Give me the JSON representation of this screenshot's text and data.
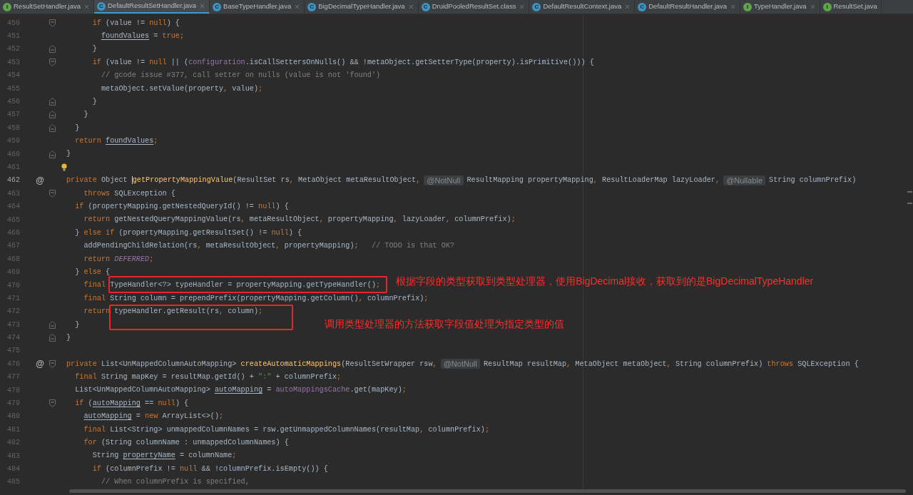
{
  "tabs": [
    {
      "label": "ResultSetHandler.java",
      "kind": "interface",
      "icon_letter": "I",
      "selected": false,
      "closable": true
    },
    {
      "label": "DefaultResultSetHandler.java",
      "kind": "class",
      "icon_letter": "C",
      "selected": true,
      "closable": true
    },
    {
      "label": "BaseTypeHandler.java",
      "kind": "class",
      "icon_letter": "C",
      "selected": false,
      "closable": true
    },
    {
      "label": "BigDecimalTypeHandler.java",
      "kind": "class",
      "icon_letter": "C",
      "selected": false,
      "closable": true
    },
    {
      "label": "DruidPooledResultSet.class",
      "kind": "class",
      "icon_letter": "C",
      "selected": false,
      "closable": true
    },
    {
      "label": "DefaultResultContext.java",
      "kind": "class",
      "icon_letter": "C",
      "selected": false,
      "closable": true
    },
    {
      "label": "DefaultResultHandler.java",
      "kind": "class",
      "icon_letter": "C",
      "selected": false,
      "closable": true
    },
    {
      "label": "TypeHandler.java",
      "kind": "interface",
      "icon_letter": "I",
      "selected": false,
      "closable": true
    },
    {
      "label": "ResultSet.java",
      "kind": "interface",
      "icon_letter": "I",
      "selected": false,
      "closable": false
    }
  ],
  "editor": {
    "lines": [
      {
        "number": "450",
        "current": false,
        "fold_marker": {
          "kind": "start"
        },
        "tokens": [
          {
            "kind": "keyword",
            "text": "      if"
          },
          {
            "kind": "plain",
            "text": " (value != "
          },
          {
            "kind": "keyword",
            "text": "null"
          },
          {
            "kind": "plain",
            "text": ") {"
          }
        ]
      },
      {
        "number": "451",
        "current": false,
        "tokens": [
          {
            "kind": "reassigned",
            "text": "        foundValues"
          },
          {
            "kind": "plain",
            "text": " = "
          },
          {
            "kind": "keyword",
            "text": "true;"
          }
        ]
      },
      {
        "number": "452",
        "current": false,
        "fold_marker": {
          "kind": "end"
        },
        "tokens": [
          {
            "kind": "plain",
            "text": "      }"
          }
        ]
      },
      {
        "number": "453",
        "current": false,
        "fold_marker": {
          "kind": "start"
        },
        "tokens": [
          {
            "kind": "keyword",
            "text": "      if"
          },
          {
            "kind": "plain",
            "text": " (value != "
          },
          {
            "kind": "keyword",
            "text": "null"
          },
          {
            "kind": "plain",
            "text": " || ("
          },
          {
            "kind": "field",
            "text": "configuration"
          },
          {
            "kind": "plain",
            "text": ".isCallSettersOnNulls() && !metaObject.getSetterType(property).isPrimitive())) {"
          }
        ]
      },
      {
        "number": "454",
        "current": false,
        "tokens": [
          {
            "kind": "comment",
            "text": "        // gcode issue #377, call setter on nulls (value is not 'found')"
          }
        ]
      },
      {
        "number": "455",
        "current": false,
        "tokens": [
          {
            "kind": "plain",
            "text": "        metaObject.setValue(property"
          },
          {
            "kind": "keyword",
            "text": ","
          },
          {
            "kind": "plain",
            "text": " value)"
          },
          {
            "kind": "keyword",
            "text": ";"
          }
        ]
      },
      {
        "number": "456",
        "current": false,
        "fold_marker": {
          "kind": "end"
        },
        "tokens": [
          {
            "kind": "plain",
            "text": "      }"
          }
        ]
      },
      {
        "number": "457",
        "current": false,
        "fold_marker": {
          "kind": "end"
        },
        "tokens": [
          {
            "kind": "plain",
            "text": "    }"
          }
        ]
      },
      {
        "number": "458",
        "current": false,
        "fold_marker": {
          "kind": "end"
        },
        "tokens": [
          {
            "kind": "plain",
            "text": "  }"
          }
        ]
      },
      {
        "number": "459",
        "current": false,
        "tokens": [
          {
            "kind": "keyword",
            "text": "  return "
          },
          {
            "kind": "reassigned",
            "text": "foundValues"
          },
          {
            "kind": "keyword",
            "text": ";"
          }
        ]
      },
      {
        "number": "460",
        "current": false,
        "fold_marker": {
          "kind": "end"
        },
        "tokens": [
          {
            "kind": "plain",
            "text": "}"
          }
        ]
      },
      {
        "number": "461",
        "current": false,
        "bulb": true
      },
      {
        "number": "462",
        "current": true,
        "gutter_mark": "@",
        "tokens": [
          {
            "kind": "keyword",
            "text": "private "
          },
          {
            "kind": "plain",
            "text": "Object "
          },
          {
            "kind": "method",
            "text": "getPropertyMappingValue",
            "cursor": true
          },
          {
            "kind": "plain",
            "text": "(ResultSet rs"
          },
          {
            "kind": "keyword",
            "text": ","
          },
          {
            "kind": "plain",
            "text": " MetaObject metaResultObject"
          },
          {
            "kind": "keyword",
            "text": ","
          },
          {
            "kind": "hint",
            "text": "@NotNull"
          },
          {
            "kind": "plain",
            "text": "ResultMapping propertyMapping"
          },
          {
            "kind": "keyword",
            "text": ","
          },
          {
            "kind": "plain",
            "text": " ResultLoaderMap lazyLoader"
          },
          {
            "kind": "keyword",
            "text": ","
          },
          {
            "kind": "hint",
            "text": "@Nullable"
          },
          {
            "kind": "plain",
            "text": "String columnPrefix)"
          }
        ]
      },
      {
        "number": "463",
        "current": false,
        "fold_marker": {
          "kind": "start"
        },
        "tokens": [
          {
            "kind": "keyword",
            "text": "    throws "
          },
          {
            "kind": "plain",
            "text": "SQLException {"
          }
        ]
      },
      {
        "number": "464",
        "current": false,
        "tokens": [
          {
            "kind": "keyword",
            "text": "  if "
          },
          {
            "kind": "plain",
            "text": "(propertyMapping.getNestedQueryId() != "
          },
          {
            "kind": "keyword",
            "text": "null"
          },
          {
            "kind": "plain",
            "text": ") {"
          }
        ]
      },
      {
        "number": "465",
        "current": false,
        "tokens": [
          {
            "kind": "keyword",
            "text": "    return "
          },
          {
            "kind": "plain",
            "text": "getNestedQueryMappingValue(rs"
          },
          {
            "kind": "keyword",
            "text": ","
          },
          {
            "kind": "plain",
            "text": " metaResultObject"
          },
          {
            "kind": "keyword",
            "text": ","
          },
          {
            "kind": "plain",
            "text": " propertyMapping"
          },
          {
            "kind": "keyword",
            "text": ","
          },
          {
            "kind": "plain",
            "text": " lazyLoader"
          },
          {
            "kind": "keyword",
            "text": ","
          },
          {
            "kind": "plain",
            "text": " columnPrefix)"
          },
          {
            "kind": "keyword",
            "text": ";"
          }
        ]
      },
      {
        "number": "466",
        "current": false,
        "tokens": [
          {
            "kind": "plain",
            "text": "  } "
          },
          {
            "kind": "keyword",
            "text": "else if "
          },
          {
            "kind": "plain",
            "text": "(propertyMapping.getResultSet() != "
          },
          {
            "kind": "keyword",
            "text": "null"
          },
          {
            "kind": "plain",
            "text": ") {"
          }
        ]
      },
      {
        "number": "467",
        "current": false,
        "tokens": [
          {
            "kind": "plain",
            "text": "    addPendingChildRelation(rs"
          },
          {
            "kind": "keyword",
            "text": ","
          },
          {
            "kind": "plain",
            "text": " metaResultObject"
          },
          {
            "kind": "keyword",
            "text": ","
          },
          {
            "kind": "plain",
            "text": " propertyMapping)"
          },
          {
            "kind": "keyword",
            "text": ";"
          },
          {
            "kind": "comment",
            "text": "   // TODO is that OK?"
          }
        ]
      },
      {
        "number": "468",
        "current": false,
        "tokens": [
          {
            "kind": "keyword",
            "text": "    return "
          },
          {
            "kind": "constant",
            "text": "DEFERRED"
          },
          {
            "kind": "keyword",
            "text": ";"
          }
        ]
      },
      {
        "number": "469",
        "current": false,
        "tokens": [
          {
            "kind": "plain",
            "text": "  } "
          },
          {
            "kind": "keyword",
            "text": "else "
          },
          {
            "kind": "plain",
            "text": "{"
          }
        ]
      },
      {
        "number": "470",
        "current": false,
        "tokens": [
          {
            "kind": "keyword",
            "text": "    final "
          },
          {
            "kind": "framed",
            "callout": "根据字段的类型获取到类型处理器，使用BigDecimal接收，获取到的是BigDecimalTypeHandler",
            "tokens": [
              {
                "kind": "plain",
                "text": "TypeHandler<?> typeHandler = propertyMapping.getTypeHandler()"
              },
              {
                "kind": "keyword",
                "text": ";"
              }
            ]
          }
        ]
      },
      {
        "number": "471",
        "current": false,
        "tokens": [
          {
            "kind": "keyword",
            "text": "    final "
          },
          {
            "kind": "plain",
            "text": "String column = prependPrefix(propertyMapping.getColumn()"
          },
          {
            "kind": "keyword",
            "text": ","
          },
          {
            "kind": "plain",
            "text": " columnPrefix)"
          },
          {
            "kind": "keyword",
            "text": ";"
          }
        ]
      },
      {
        "number": "472",
        "current": false,
        "tokens": [
          {
            "kind": "keyword",
            "text": "    return "
          },
          {
            "kind": "framed",
            "callout": "调用类型处理器的方法获取字段值处理为指定类型的值",
            "tokens": [
              {
                "kind": "plain",
                "text": "typeHandler.getResult(rs"
              },
              {
                "kind": "keyword",
                "text": ","
              },
              {
                "kind": "plain",
                "text": " column)"
              },
              {
                "kind": "keyword",
                "text": ";"
              }
            ]
          }
        ]
      },
      {
        "number": "473",
        "current": false,
        "fold_marker": {
          "kind": "end"
        },
        "tokens": [
          {
            "kind": "plain",
            "text": "  }"
          }
        ]
      },
      {
        "number": "474",
        "current": false,
        "fold_marker": {
          "kind": "end"
        },
        "tokens": [
          {
            "kind": "plain",
            "text": "}"
          }
        ]
      },
      {
        "number": "475",
        "current": false
      },
      {
        "number": "476",
        "current": false,
        "gutter_mark": "@",
        "fold_marker": {
          "kind": "start"
        },
        "tokens": [
          {
            "kind": "keyword",
            "text": "private "
          },
          {
            "kind": "plain",
            "text": "List<UnMappedColumnAutoMapping> "
          },
          {
            "kind": "method",
            "text": "createAutomaticMappings"
          },
          {
            "kind": "plain",
            "text": "(ResultSetWrapper rsw"
          },
          {
            "kind": "keyword",
            "text": ","
          },
          {
            "kind": "hint",
            "text": "@NotNull"
          },
          {
            "kind": "plain",
            "text": "ResultMap resultMap"
          },
          {
            "kind": "keyword",
            "text": ","
          },
          {
            "kind": "plain",
            "text": " MetaObject metaObject"
          },
          {
            "kind": "keyword",
            "text": ","
          },
          {
            "kind": "plain",
            "text": " String columnPrefix) "
          },
          {
            "kind": "keyword",
            "text": "throws "
          },
          {
            "kind": "plain",
            "text": "SQLException {"
          }
        ]
      },
      {
        "number": "477",
        "current": false,
        "tokens": [
          {
            "kind": "keyword",
            "text": "  final "
          },
          {
            "kind": "plain",
            "text": "String mapKey = resultMap.getId() + "
          },
          {
            "kind": "string",
            "text": "\":\""
          },
          {
            "kind": "plain",
            "text": " + columnPrefix"
          },
          {
            "kind": "keyword",
            "text": ";"
          }
        ]
      },
      {
        "number": "478",
        "current": false,
        "tokens": [
          {
            "kind": "plain",
            "text": "  List<UnMappedColumnAutoMapping> "
          },
          {
            "kind": "reassigned",
            "text": "autoMapping"
          },
          {
            "kind": "plain",
            "text": " = "
          },
          {
            "kind": "field",
            "text": "autoMappingsCache"
          },
          {
            "kind": "plain",
            "text": ".get(mapKey)"
          },
          {
            "kind": "keyword",
            "text": ";"
          }
        ]
      },
      {
        "number": "479",
        "current": false,
        "fold_marker": {
          "kind": "start"
        },
        "tokens": [
          {
            "kind": "keyword",
            "text": "  if "
          },
          {
            "kind": "plain",
            "text": "("
          },
          {
            "kind": "reassigned",
            "text": "autoMapping"
          },
          {
            "kind": "plain",
            "text": " == "
          },
          {
            "kind": "keyword",
            "text": "null"
          },
          {
            "kind": "plain",
            "text": ") {"
          }
        ]
      },
      {
        "number": "480",
        "current": false,
        "tokens": [
          {
            "kind": "reassigned",
            "text": "    autoMapping"
          },
          {
            "kind": "plain",
            "text": " = "
          },
          {
            "kind": "keyword",
            "text": "new "
          },
          {
            "kind": "plain",
            "text": "ArrayList<>()"
          },
          {
            "kind": "keyword",
            "text": ";"
          }
        ]
      },
      {
        "number": "481",
        "current": false,
        "tokens": [
          {
            "kind": "keyword",
            "text": "    final "
          },
          {
            "kind": "plain",
            "text": "List<String> unmappedColumnNames = rsw.getUnmappedColumnNames(resultMap"
          },
          {
            "kind": "keyword",
            "text": ","
          },
          {
            "kind": "plain",
            "text": " columnPrefix)"
          },
          {
            "kind": "keyword",
            "text": ";"
          }
        ]
      },
      {
        "number": "482",
        "current": false,
        "tokens": [
          {
            "kind": "keyword",
            "text": "    for "
          },
          {
            "kind": "plain",
            "text": "(String columnName : unmappedColumnNames) {"
          }
        ]
      },
      {
        "number": "483",
        "current": false,
        "tokens": [
          {
            "kind": "plain",
            "text": "      String "
          },
          {
            "kind": "reassigned",
            "text": "propertyName"
          },
          {
            "kind": "plain",
            "text": " = columnName"
          },
          {
            "kind": "keyword",
            "text": ";"
          }
        ]
      },
      {
        "number": "484",
        "current": false,
        "tokens": [
          {
            "kind": "keyword",
            "text": "      if "
          },
          {
            "kind": "plain",
            "text": "(columnPrefix != "
          },
          {
            "kind": "keyword",
            "text": "null "
          },
          {
            "kind": "plain",
            "text": "&& !columnPrefix.isEmpty()) {"
          }
        ]
      },
      {
        "number": "485",
        "current": false,
        "tokens": [
          {
            "kind": "comment",
            "text": "        // When columnPrefix is specified,"
          }
        ]
      }
    ]
  }
}
